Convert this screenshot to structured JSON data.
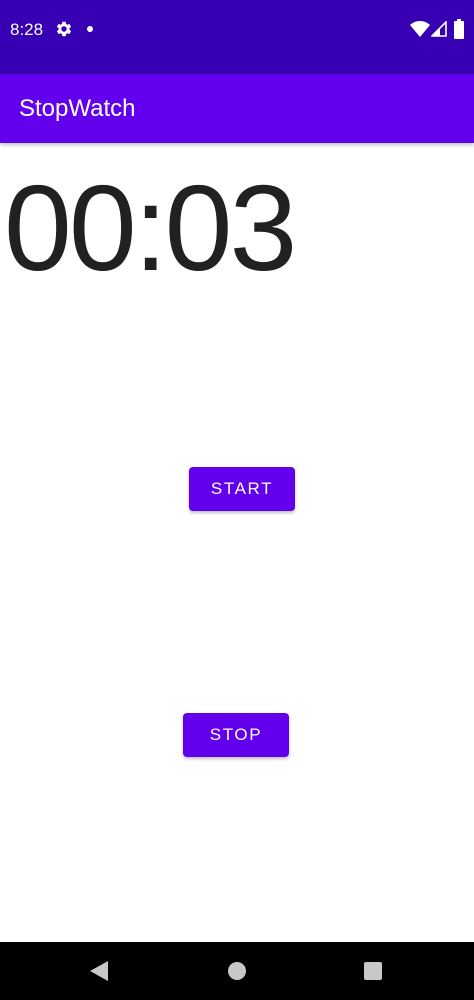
{
  "status_bar": {
    "time": "8:28",
    "icons": [
      "settings-gear-icon",
      "notification-dot-icon",
      "wifi-icon",
      "cell-signal-icon",
      "battery-icon"
    ]
  },
  "app_bar": {
    "title": "StopWatch"
  },
  "timer": {
    "display": "00:03"
  },
  "buttons": {
    "start_label": "START",
    "stop_label": "STOP"
  },
  "nav_bar": {
    "icons": [
      "back-icon",
      "home-icon",
      "recents-icon"
    ]
  },
  "colors": {
    "status_bar": "#3700b3",
    "primary": "#6200ee",
    "timer_text": "#212121",
    "background": "#ffffff",
    "nav_bar": "#000000"
  }
}
